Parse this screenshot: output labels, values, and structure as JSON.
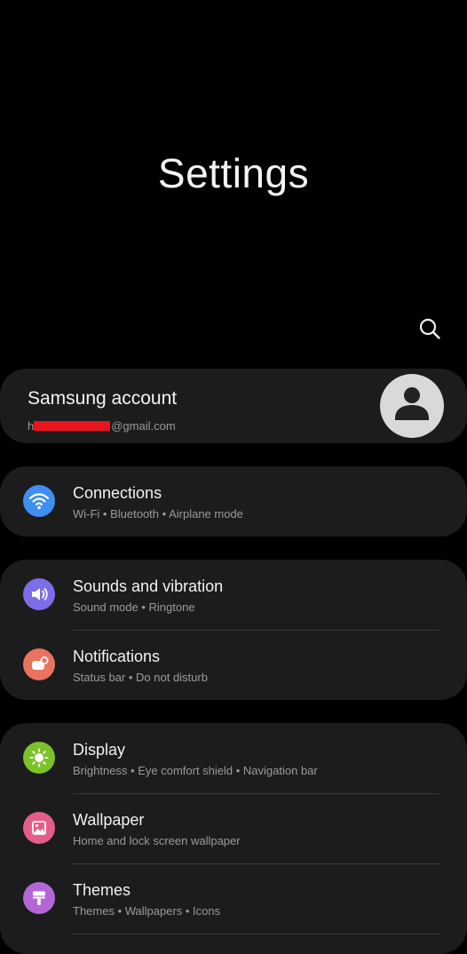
{
  "header": {
    "title": "Settings"
  },
  "search": {
    "icon": "search-icon"
  },
  "account": {
    "name": "Samsung account",
    "email_prefix": "h",
    "email_suffix": "@gmail.com"
  },
  "groups": {
    "connections": {
      "title": "Connections",
      "subtitle": "Wi-Fi  •  Bluetooth  •  Airplane mode",
      "icon": "wifi-icon",
      "icon_color": "#3e8ff0"
    },
    "sounds": {
      "title": "Sounds and vibration",
      "subtitle": "Sound mode  •  Ringtone",
      "icon": "speaker-icon",
      "icon_color": "#7b6ee8"
    },
    "notifications": {
      "title": "Notifications",
      "subtitle": "Status bar  •  Do not disturb",
      "icon": "notification-icon",
      "icon_color": "#e8735e"
    },
    "display": {
      "title": "Display",
      "subtitle": "Brightness  •  Eye comfort shield  •  Navigation bar",
      "icon": "sun-icon",
      "icon_color": "#7cc22a"
    },
    "wallpaper": {
      "title": "Wallpaper",
      "subtitle": "Home and lock screen wallpaper",
      "icon": "image-icon",
      "icon_color": "#e55e8a"
    },
    "themes": {
      "title": "Themes",
      "subtitle": "Themes  •  Wallpapers  •  Icons",
      "icon": "paintbrush-icon",
      "icon_color": "#b466d6"
    }
  }
}
